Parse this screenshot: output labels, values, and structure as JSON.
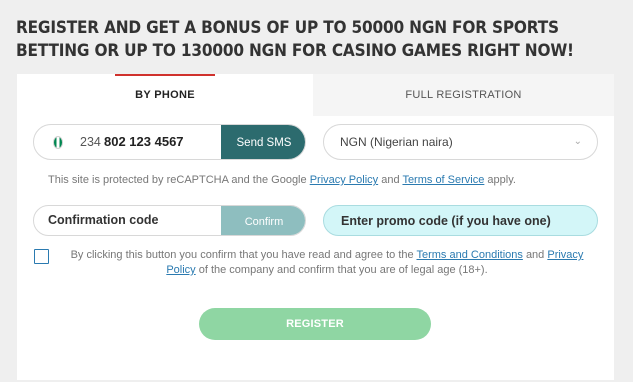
{
  "headline": "REGISTER AND GET A BONUS OF UP TO 50000 NGN FOR SPORTS BETTING OR UP TO 130000 NGN FOR CASINO GAMES RIGHT NOW!",
  "tabs": [
    {
      "label": "BY PHONE",
      "active": true
    },
    {
      "label": "FULL REGISTRATION",
      "active": false
    }
  ],
  "phone": {
    "country_flag": "nigeria-flag-icon",
    "prefix": "234",
    "value": "802 123 4567",
    "send_label": "Send SMS"
  },
  "currency": {
    "selected": "NGN (Nigerian naira)"
  },
  "captcha": {
    "prefix": "This site is protected by reCAPTCHA and the Google",
    "privacy_link": "Privacy Policy",
    "and": "and",
    "terms_link": "Terms of Service",
    "suffix": "apply."
  },
  "confirmation": {
    "placeholder": "Confirmation code",
    "button_label": "Confirm"
  },
  "promo": {
    "placeholder": "Enter promo code (if you have one)"
  },
  "consent": {
    "text1": "By clicking this button you confirm that you have read and agree to the",
    "terms_link": "Terms and Conditions",
    "and": "and",
    "privacy_link": "Privacy Policy",
    "text2": "of the company and confirm that you are of legal age (18+)."
  },
  "register_label": "REGISTER",
  "colors": {
    "accent_red": "#d0312d",
    "sms_button": "#2c6b6e",
    "confirm_button": "#8ebebf",
    "promo_bg": "#d3f6f8",
    "register_button": "#8fd6a3",
    "link": "#2a7ab0"
  }
}
